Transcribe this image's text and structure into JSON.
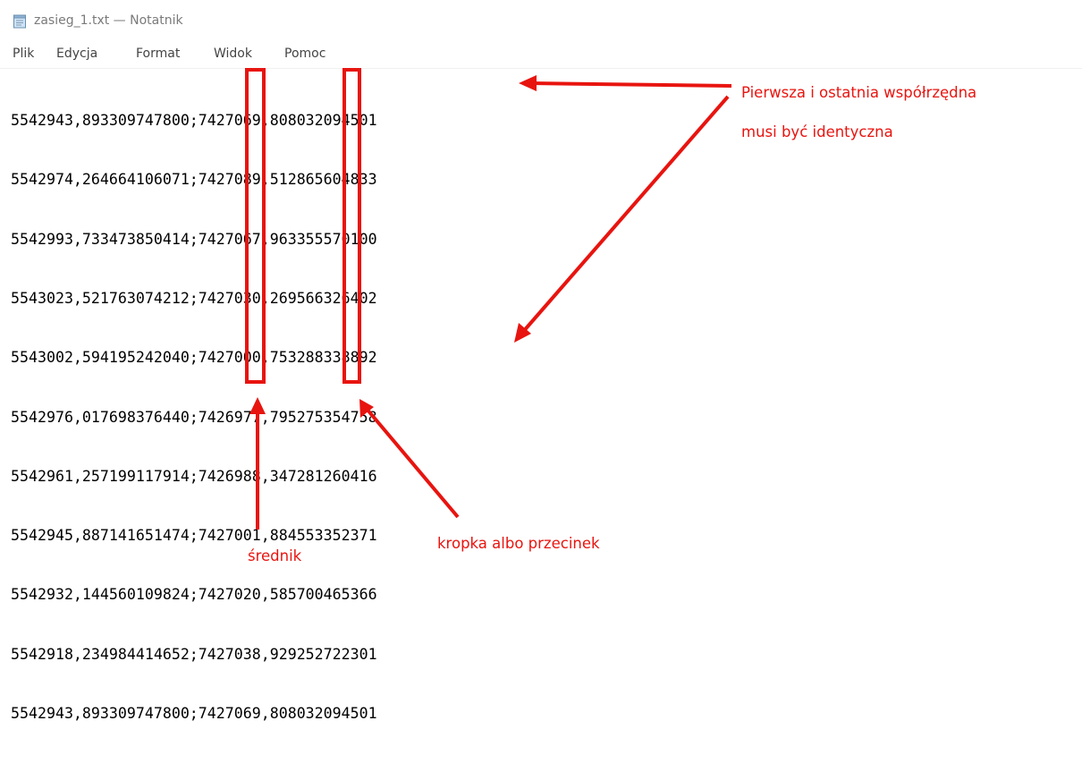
{
  "window": {
    "title": "zasieg_1.txt — Notatnik",
    "icon": "notepad-icon"
  },
  "menu": {
    "items": [
      "Plik",
      "Edycja",
      "Format",
      "Widok",
      "Pomoc"
    ]
  },
  "editor": {
    "lines": [
      "5542943,893309747800;7427069,808032094501",
      "5542974,264664106071;7427089,512865604833",
      "5542993,733473850414;7427067,963355570100",
      "5543023,521763074212;7427030,269566326402",
      "5543002,594195242040;7427000,753288338892",
      "5542976,017698376440;7426977,795275354758",
      "5542961,257199117914;7426988,347281260416",
      "5542945,887141651474;7427001,884553352371",
      "5542932,144560109824;7427020,585700465366",
      "5542918,234984414652;7427038,929252722301",
      "5542943,893309747800;7427069,808032094501"
    ]
  },
  "annotations": {
    "first_last_line1": "Pierwsza i ostatnia współrzędna",
    "first_last_line2": "musi być identyczna",
    "semicolon": "średnik",
    "dot_or_comma": "kropka albo przecinek",
    "color": "#e8140f"
  }
}
